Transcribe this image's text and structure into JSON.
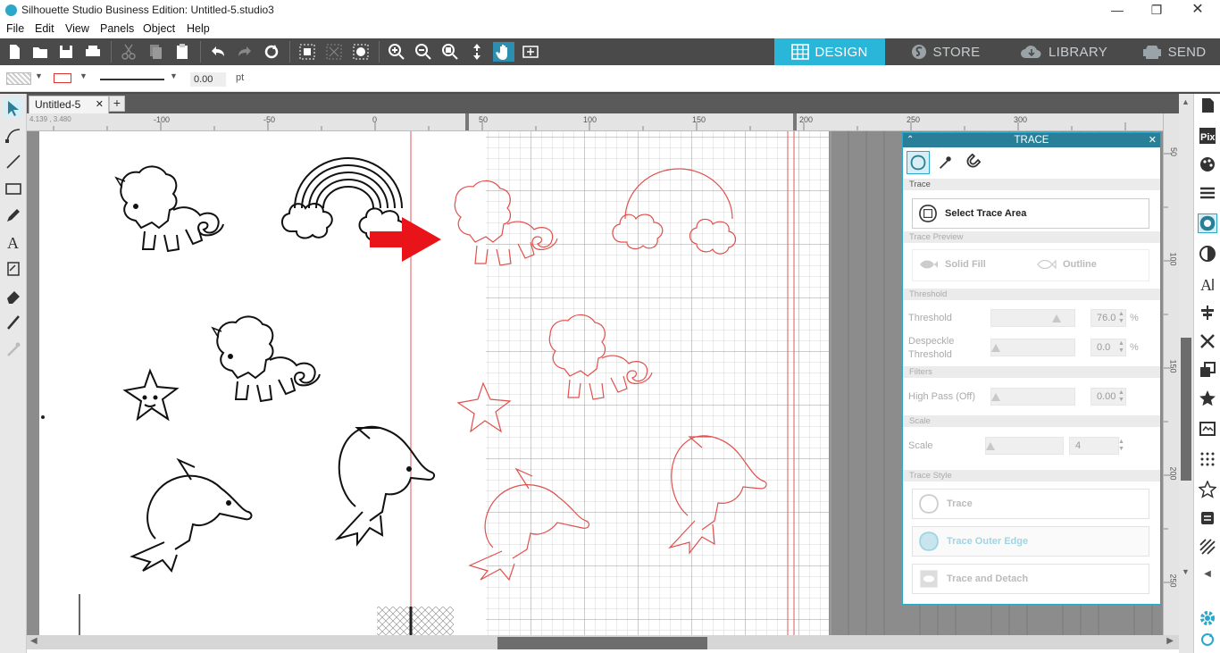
{
  "window": {
    "title": "Silhouette Studio Business Edition: Untitled-5.studio3"
  },
  "menu": [
    "File",
    "Edit",
    "View",
    "Panels",
    "Object",
    "Help"
  ],
  "nav_tabs": [
    {
      "label": "DESIGN",
      "icon": "grid-icon",
      "active": true
    },
    {
      "label": "STORE",
      "icon": "store-icon",
      "active": false
    },
    {
      "label": "LIBRARY",
      "icon": "cloud-icon",
      "active": false
    },
    {
      "label": "SEND",
      "icon": "printer-send-icon",
      "active": false
    }
  ],
  "properties": {
    "line_width_value": "0.00",
    "line_width_unit": "pt"
  },
  "document": {
    "tab_label": "Untitled-5",
    "new_tab_label": "+",
    "coordinates": "4.139 , 3.480"
  },
  "ruler": {
    "labels": [
      "-100",
      "-50",
      "0",
      "50",
      "100",
      "150",
      "200",
      "250",
      "300"
    ],
    "v_labels": [
      "50",
      "100",
      "150",
      "200",
      "250"
    ]
  },
  "trace_panel": {
    "title": "TRACE",
    "section_trace": "Trace",
    "select_trace_area": "Select Trace Area",
    "section_preview": "Trace Preview",
    "solid_fill": "Solid Fill",
    "outline": "Outline",
    "section_threshold": "Threshold",
    "threshold_label": "Threshold",
    "threshold_value": "76.0",
    "threshold_unit": "%",
    "despeckle_label_1": "Despeckle",
    "despeckle_label_2": "Threshold",
    "despeckle_value": "0.0",
    "despeckle_unit": "%",
    "section_filters": "Filters",
    "highpass_label": "High Pass (Off)",
    "highpass_value": "0.00",
    "section_scale": "Scale",
    "scale_label": "Scale",
    "scale_value": "4",
    "section_style": "Trace Style",
    "style_trace": "Trace",
    "style_outer": "Trace Outer Edge",
    "style_detach": "Trace and Detach"
  },
  "colors": {
    "accent": "#29b6d9",
    "toolbar": "#4a4a4a",
    "trace_line": "#e0504c",
    "panel_header": "#2a7f98"
  }
}
